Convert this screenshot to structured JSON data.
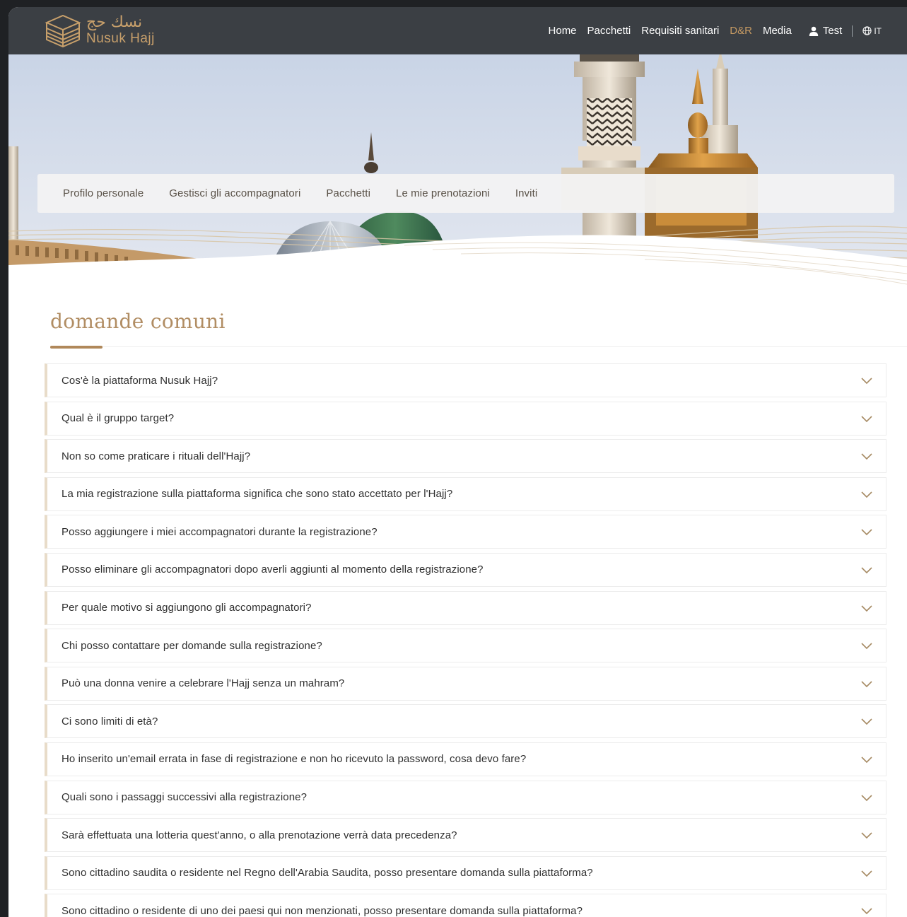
{
  "brand": {
    "arabic": "نسك حج",
    "name": "Nusuk Hajj"
  },
  "nav": {
    "items": [
      {
        "label": "Home",
        "active": false
      },
      {
        "label": "Pacchetti",
        "active": false
      },
      {
        "label": "Requisiti sanitari",
        "active": false
      },
      {
        "label": "D&R",
        "active": true
      },
      {
        "label": "Media",
        "active": false
      }
    ],
    "user": {
      "icon": "user-icon",
      "label": "Test"
    },
    "language": {
      "icon": "globe-icon",
      "label": "IT"
    }
  },
  "subnav": {
    "items": [
      "Profilo personale",
      "Gestisci gli accompagnatori",
      "Pacchetti",
      "Le mie prenotazioni",
      "Inviti"
    ]
  },
  "page": {
    "title": "domande comuni"
  },
  "faq": {
    "items": [
      "Cos'è la piattaforma Nusuk Hajj?",
      "Qual è il gruppo target?",
      "Non so come praticare i rituali dell'Hajj?",
      "La mia registrazione sulla piattaforma significa che sono stato accettato per l'Hajj?",
      "Posso aggiungere i miei accompagnatori durante la registrazione?",
      "Posso eliminare gli accompagnatori dopo averli aggiunti al momento della registrazione?",
      "Per quale motivo si aggiungono gli accompagnatori?",
      "Chi posso contattare per domande sulla registrazione?",
      "Può una donna venire a celebrare l'Hajj senza un mahram?",
      "Ci sono limiti di età?",
      "Ho inserito un'email errata in fase di registrazione e non ho ricevuto la password, cosa devo fare?",
      "Quali sono i passaggi successivi alla registrazione?",
      "Sarà effettuata una lotteria quest'anno, o alla prenotazione verrà data precedenza?",
      "Sono cittadino saudita o residente nel Regno dell'Arabia Saudita, posso presentare domanda sulla piattaforma?",
      "Sono cittadino o residente di uno dei paesi qui non menzionati, posso presentare domanda sulla piattaforma?"
    ],
    "chevron_icon": "chevron-down-icon"
  },
  "colors": {
    "header_bg": "#3b3f44",
    "accent_gold": "#c59a63",
    "title": "#b18d63",
    "subnav_text": "#5a5248"
  }
}
